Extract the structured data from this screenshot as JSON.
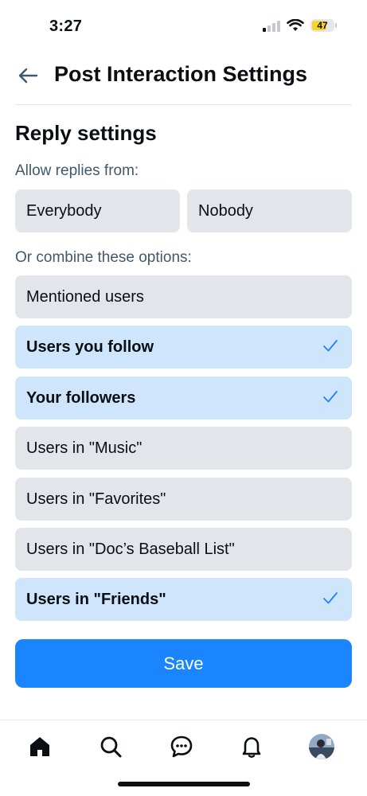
{
  "status_bar": {
    "time": "3:27",
    "battery": "47",
    "battery_color": "#f6d32d"
  },
  "header": {
    "title": "Post Interaction Settings"
  },
  "reply_settings": {
    "title": "Reply settings",
    "allow_label": "Allow replies from:",
    "everybody": "Everybody",
    "nobody": "Nobody",
    "combine_label": "Or combine these options:",
    "options": [
      {
        "label": "Mentioned users",
        "selected": false
      },
      {
        "label": "Users you follow",
        "selected": true
      },
      {
        "label": "Your followers",
        "selected": true
      },
      {
        "label": "Users in \"Music\"",
        "selected": false
      },
      {
        "label": "Users in \"Favorites\"",
        "selected": false
      },
      {
        "label": "Users in \"Doc’s Baseball List\"",
        "selected": false
      },
      {
        "label": "Users in \"Friends\"",
        "selected": true
      }
    ]
  },
  "save_label": "Save",
  "colors": {
    "accent": "#1a85ff",
    "selected_bg": "#cfe5fb",
    "option_bg": "#e2e6ea",
    "secondary_text": "#42576b"
  },
  "tabbar": {
    "items": [
      {
        "icon": "home-icon"
      },
      {
        "icon": "search-icon"
      },
      {
        "icon": "chat-icon"
      },
      {
        "icon": "bell-icon"
      },
      {
        "icon": "avatar"
      }
    ]
  }
}
